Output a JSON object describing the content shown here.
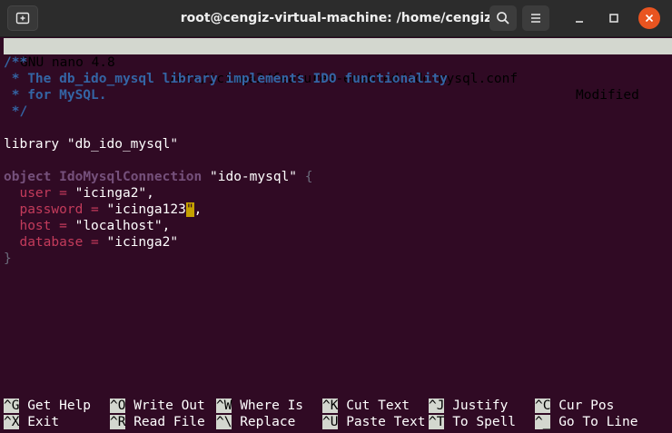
{
  "window": {
    "title": "root@cengiz-virtual-machine: /home/cengiz",
    "icons": {
      "new_tab": "new-tab-icon",
      "search": "search-icon",
      "menu": "hamburger-menu-icon",
      "minimize": "minimize-icon",
      "maximize": "maximize-icon",
      "close": "close-icon"
    },
    "colors": {
      "terminal_bg": "#300a24",
      "close_button": "#e95420",
      "comment": "#3465a4",
      "keyword": "#75507b",
      "attribute": "#c33b5b",
      "cursor": "#c4a000"
    }
  },
  "nano": {
    "status": {
      "program": "GNU nano 4.8",
      "file": "/etc/icinga2/features-enabled/ido-mysql.conf",
      "state": "Modified"
    },
    "code": {
      "l1": "/**",
      "l2": " * The db_ido_mysql library implements IDO functionality",
      "l3": " * for MySQL.",
      "l4": " */",
      "l6_kw": "library",
      "l6_str": "\"db_ido_mysql\"",
      "l8_kw": "object",
      "l8_type": "IdoMysqlConnection",
      "l8_str": "\"ido-mysql\"",
      "l8_brace": "{",
      "user_key": "user",
      "user_eq": " = ",
      "user_val": "\"icinga2\",",
      "pass_key": "password",
      "pass_eq": " = ",
      "pass_val": "\"icinga123",
      "pass_cursor": "\"",
      "pass_tail": ",",
      "host_key": "host",
      "host_eq": " = ",
      "host_val": "\"localhost\",",
      "db_key": "database",
      "db_eq": " = ",
      "db_val": "\"icinga2\"",
      "close_brace": "}"
    },
    "shortcuts": {
      "row1": [
        {
          "key": "^G",
          "label": "Get Help"
        },
        {
          "key": "^O",
          "label": "Write Out"
        },
        {
          "key": "^W",
          "label": "Where Is"
        },
        {
          "key": "^K",
          "label": "Cut Text"
        },
        {
          "key": "^J",
          "label": "Justify"
        },
        {
          "key": "^C",
          "label": "Cur Pos"
        }
      ],
      "row2": [
        {
          "key": "^X",
          "label": "Exit"
        },
        {
          "key": "^R",
          "label": "Read File"
        },
        {
          "key": "^\\",
          "label": "Replace"
        },
        {
          "key": "^U",
          "label": "Paste Text"
        },
        {
          "key": "^T",
          "label": "To Spell"
        },
        {
          "key": "^_",
          "label": "Go To Line"
        }
      ]
    }
  }
}
